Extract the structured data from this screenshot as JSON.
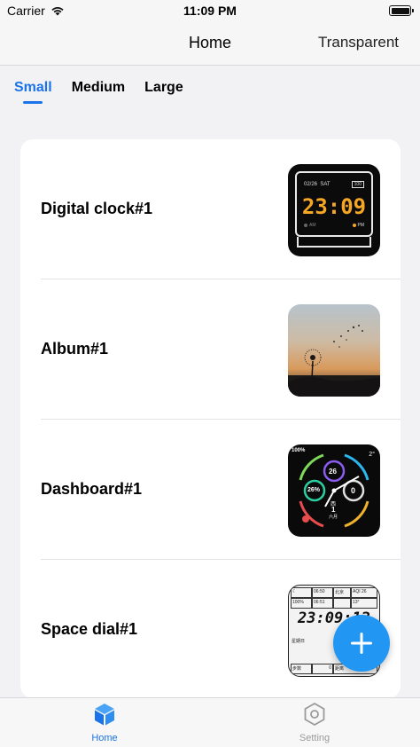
{
  "status_bar": {
    "carrier": "Carrier",
    "time": "11:09 PM"
  },
  "nav": {
    "title": "Home",
    "right_button": "Transparent"
  },
  "tabs": [
    {
      "label": "Small",
      "active": true
    },
    {
      "label": "Medium",
      "active": false
    },
    {
      "label": "Large",
      "active": false
    }
  ],
  "widgets": [
    {
      "name": "Digital clock#1",
      "preview": {
        "date": "02/26",
        "day": "SAT",
        "battery": "100",
        "time": "23:09",
        "am": "AM",
        "pm": "PM"
      }
    },
    {
      "name": "Album#1"
    },
    {
      "name": "Dashboard#1",
      "preview": {
        "battery_pct": "100%",
        "top_value": "26",
        "left_value": "26%",
        "right_value": "0",
        "day_char": "西",
        "date_num": "1",
        "month_char": "六月",
        "temp": "2°"
      }
    },
    {
      "name": "Space dial#1",
      "preview": {
        "city": "北京",
        "aqi": "AQI 26",
        "time_small": "06:50",
        "time2": "06:51",
        "battery": "100%",
        "big_time": "23:09:12",
        "temp": "13°",
        "steps_label": "步数",
        "steps": "0",
        "km_label": "距离",
        "day_label": "星期日"
      }
    }
  ],
  "tab_bar": [
    {
      "label": "Home",
      "icon": "cube-icon",
      "active": true
    },
    {
      "label": "Setting",
      "icon": "hexagon-gear-icon",
      "active": false
    }
  ],
  "colors": {
    "accent": "#1a73e8",
    "fab": "#2196f3",
    "clock_digits": "#f5a623"
  }
}
